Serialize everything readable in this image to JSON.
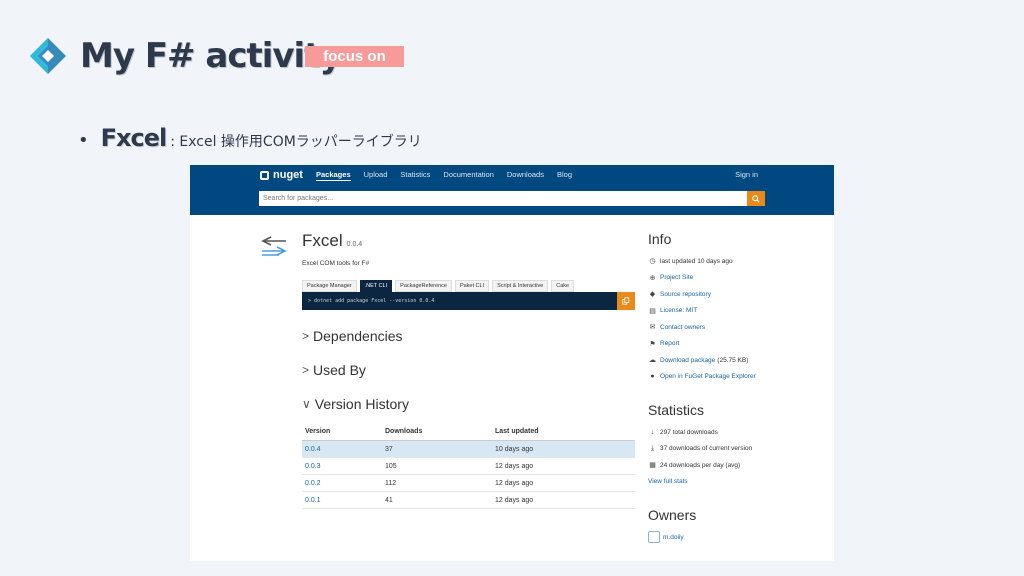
{
  "slide": {
    "title": "My F# activity",
    "badge": "focus on",
    "bullet_strong": "Fxcel",
    "bullet_rest": ": Excel 操作用COMラッパーライブラリ",
    "colors": {
      "title": "#2e3a4b",
      "badge_bg": "#f69a9a",
      "background": "#f1f4f9"
    }
  },
  "nuget": {
    "logo_text": "nuget",
    "nav": [
      "Packages",
      "Upload",
      "Statistics",
      "Documentation",
      "Downloads",
      "Blog"
    ],
    "active_nav": "Packages",
    "sign_in": "Sign in",
    "search_placeholder": "Search for packages...",
    "package": {
      "name": "Fxcel",
      "version": "0.0.4",
      "description": "Excel COM tools for F#"
    },
    "cli_tabs": [
      "Package Manager",
      ".NET CLI",
      "PackageReference",
      "Paket CLI",
      "Script & Interactive",
      "Cake"
    ],
    "active_cli_tab": ".NET CLI",
    "cli_command": "> dotnet add package Fxcel --version 0.0.4",
    "sections": {
      "dependencies": "Dependencies",
      "used_by": "Used By",
      "version_history": "Version History"
    },
    "version_table": {
      "headers": [
        "Version",
        "Downloads",
        "Last updated"
      ],
      "rows": [
        {
          "version": "0.0.4",
          "downloads": "37",
          "updated": "10 days ago"
        },
        {
          "version": "0.0.3",
          "downloads": "105",
          "updated": "12 days ago"
        },
        {
          "version": "0.0.2",
          "downloads": "112",
          "updated": "12 days ago"
        },
        {
          "version": "0.0.1",
          "downloads": "41",
          "updated": "12 days ago"
        }
      ]
    },
    "info": {
      "heading": "Info",
      "last_updated": "last updated 10 days ago",
      "project_site": "Project Site",
      "source_repo": "Source repository",
      "license": "License: MIT",
      "contact": "Contact owners",
      "report": "Report",
      "download": "Download package",
      "download_size": "(25.75 KB)",
      "fuget": "Open in FuGet Package Explorer"
    },
    "statistics": {
      "heading": "Statistics",
      "total": "297 total downloads",
      "current": "37 downloads of current version",
      "per_day": "24 downloads per day (avg)",
      "full": "View full stats"
    },
    "owners": {
      "heading": "Owners",
      "name": "m.doliy"
    },
    "colors": {
      "header": "#004880",
      "accent": "#e9891a",
      "cli": "#0b2640",
      "link": "#1a64a8"
    }
  }
}
